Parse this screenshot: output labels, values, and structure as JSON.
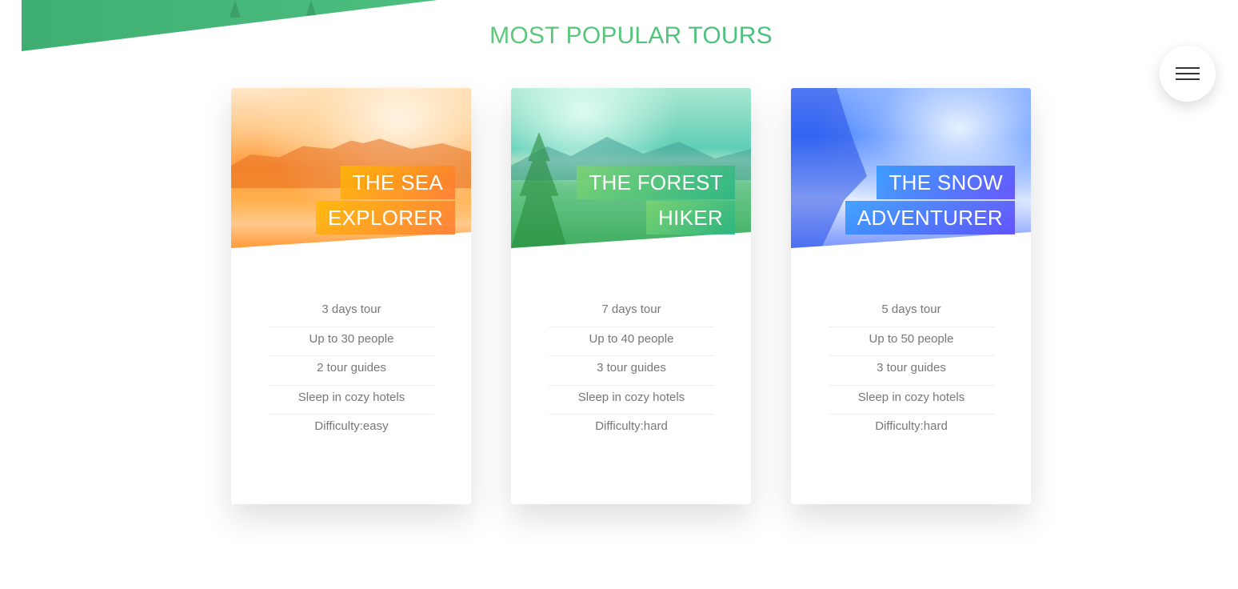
{
  "section": {
    "title": "MOST POPULAR TOURS"
  },
  "navigation": {
    "menu_icon": "hamburger-menu-icon"
  },
  "tours": [
    {
      "heading_line1": "THE SEA",
      "heading_line2": "EXPLORER",
      "details": [
        "3 days tour",
        "Up to 30 people",
        "2 tour guides",
        "Sleep in cozy hotels",
        "Difficulty:easy"
      ],
      "accent": [
        "#ffb900",
        "#ff7730"
      ]
    },
    {
      "heading_line1": "THE FOREST",
      "heading_line2": "HIKER",
      "details": [
        "7 days tour",
        "Up to 40 people",
        "3 tour guides",
        "Sleep in cozy hotels",
        "Difficulty:hard"
      ],
      "accent": [
        "#7ed56f",
        "#28b485"
      ]
    },
    {
      "heading_line1": "THE SNOW",
      "heading_line2": "ADVENTURER",
      "details": [
        "5 days tour",
        "Up to 50 people",
        "3 tour guides",
        "Sleep in cozy hotels",
        "Difficulty:hard"
      ],
      "accent": [
        "#2998ff",
        "#5643fa"
      ]
    }
  ]
}
